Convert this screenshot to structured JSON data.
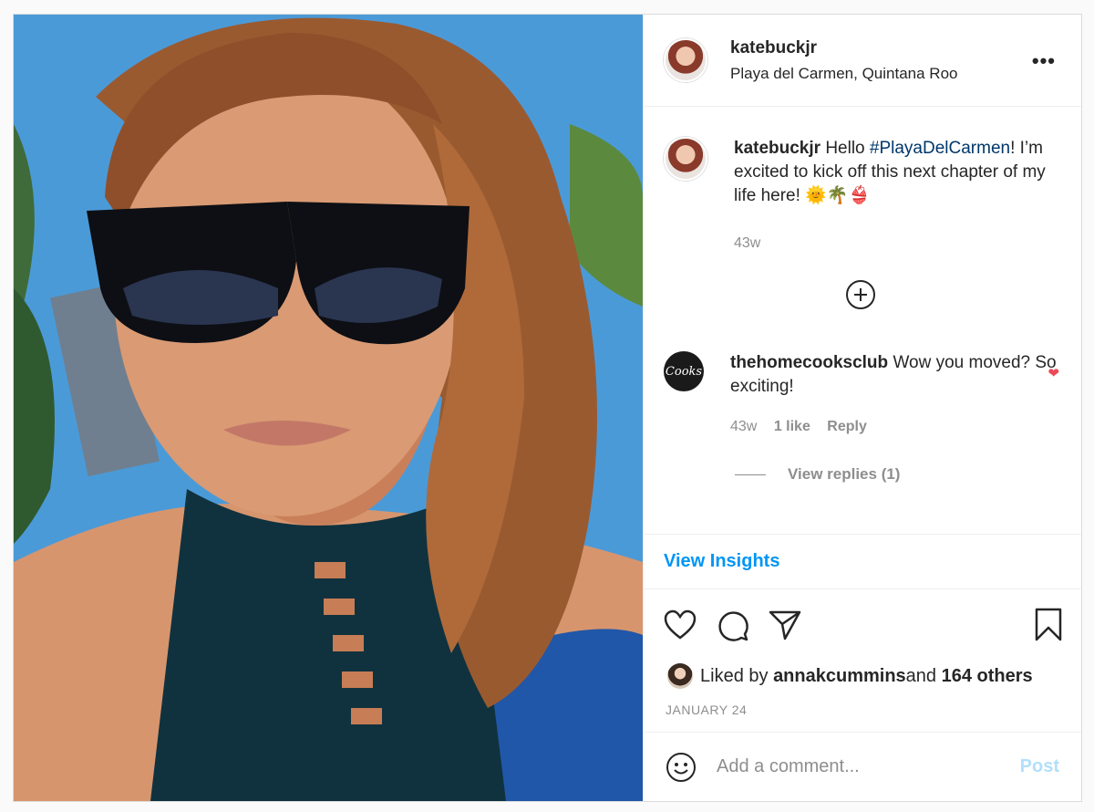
{
  "post": {
    "username": "katebuckjr",
    "location": "Playa del Carmen, Quintana Roo",
    "more_label": "•••"
  },
  "caption": {
    "username": "katebuckjr",
    "text_before": "Hello ",
    "hashtag": "#PlayaDelCarmen",
    "text_after": "! I’m excited to kick off this next chapter of my life here! 🌞🌴👙",
    "age": "43w"
  },
  "comments": [
    {
      "username": "thehomecooksclub",
      "text": "Wow you moved? So exciting!",
      "age": "43w",
      "likes": "1 like",
      "reply_label": "Reply",
      "liked": true,
      "avatar_text": "Cooks"
    }
  ],
  "view_replies": "View replies (1)",
  "view_insights": "View Insights",
  "likes": {
    "prefix": "Liked by ",
    "user": "annakcummins",
    "middle": " and ",
    "others": "164 others"
  },
  "date": "JANUARY 24",
  "add_comment": {
    "placeholder": "Add a comment...",
    "post_label": "Post"
  },
  "colors": {
    "link": "#0095f6",
    "hashtag": "#00376b",
    "heart": "#ed4956",
    "muted": "#8e8e8e"
  }
}
